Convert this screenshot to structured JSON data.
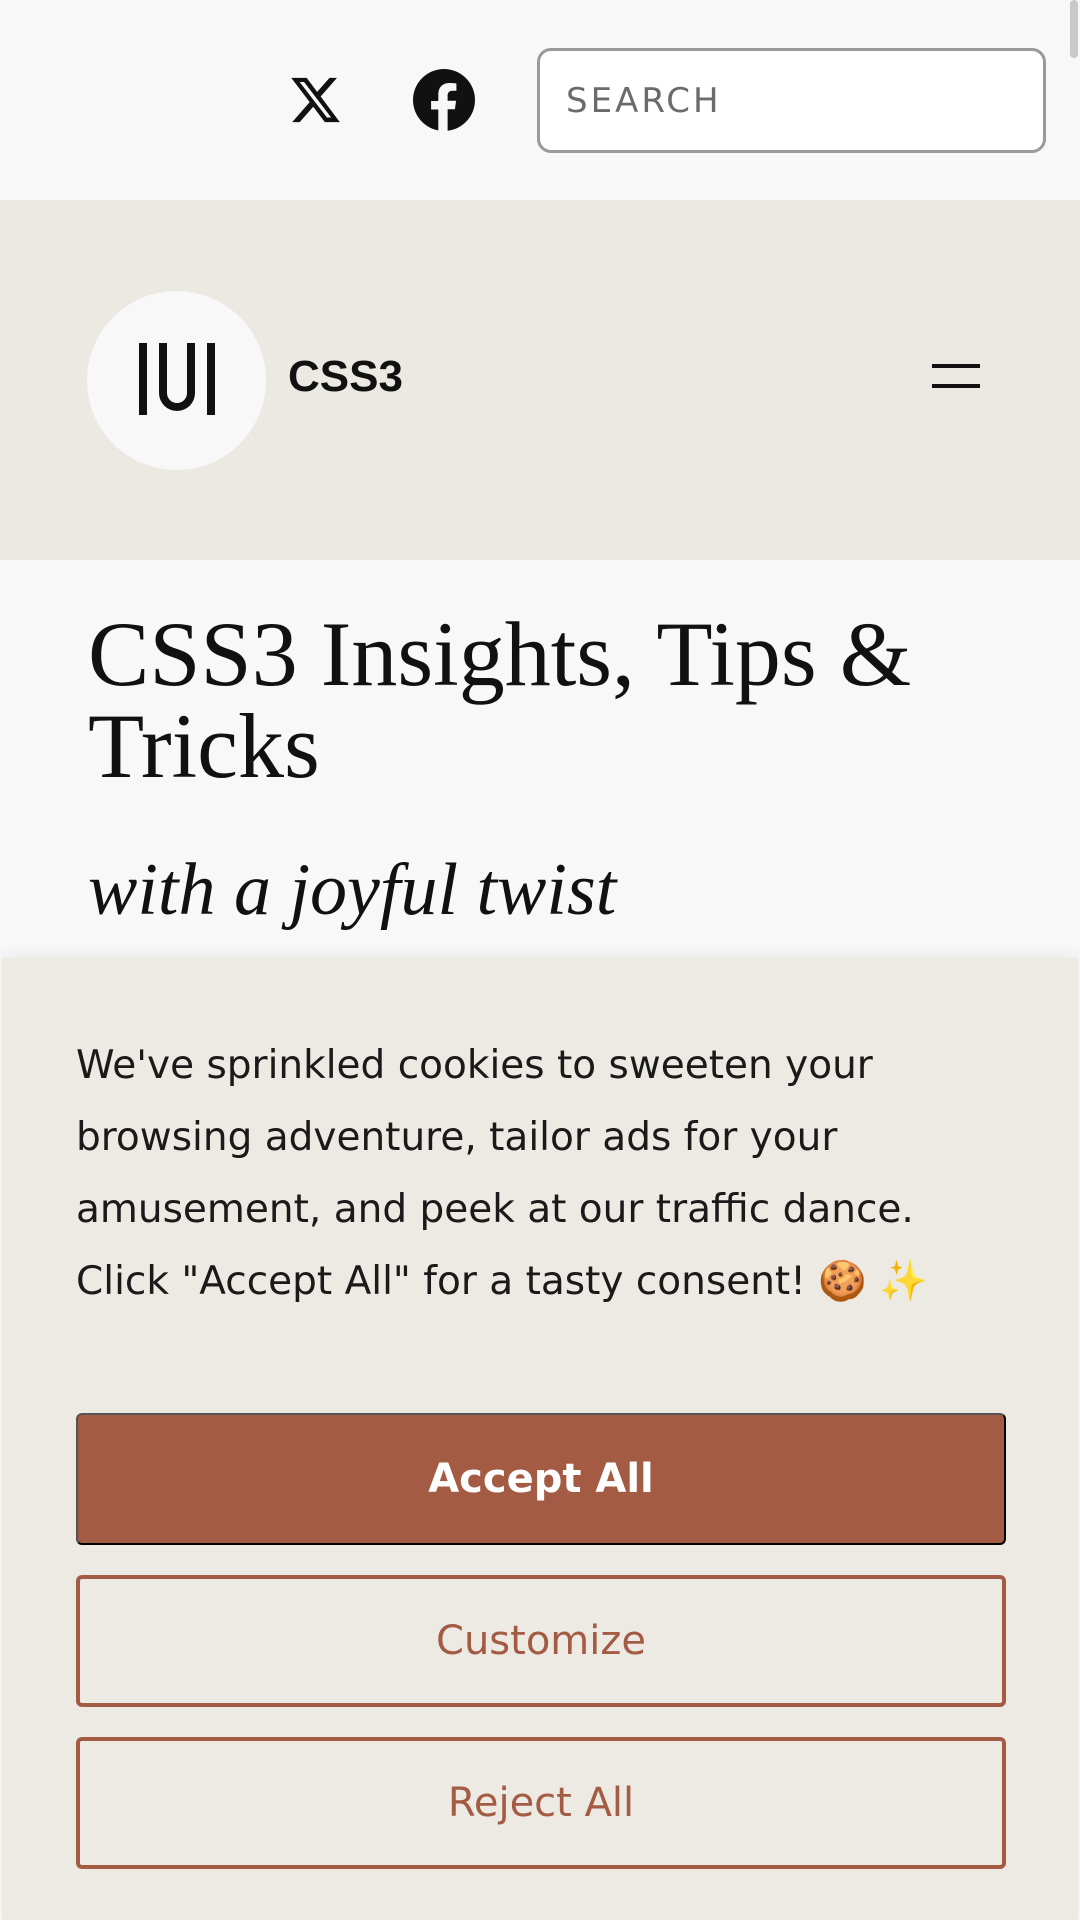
{
  "topbar": {
    "social_icons": [
      "x-icon",
      "facebook-icon"
    ],
    "search": {
      "placeholder": "SEARCH",
      "value": ""
    }
  },
  "header": {
    "logo_icon": "iui-logo-icon",
    "site_name": "CSS3",
    "menu_icon": "hamburger-menu-icon"
  },
  "hero": {
    "title": "CSS3 Insights, Tips & Tricks",
    "subtitle": "with a joyful twist"
  },
  "cookie_banner": {
    "message": "We've sprinkled cookies to sweeten your browsing adventure, tailor ads for your amusement, and peek at our traffic dance. Click \"Accept All\" for a tasty consent! 🍪 ✨",
    "accept_label": "Accept All",
    "customize_label": "Customize",
    "reject_label": "Reject All"
  },
  "colors": {
    "accent": "#a35b44",
    "header_bg": "#ece9e3",
    "page_bg": "#f8f8f8"
  }
}
